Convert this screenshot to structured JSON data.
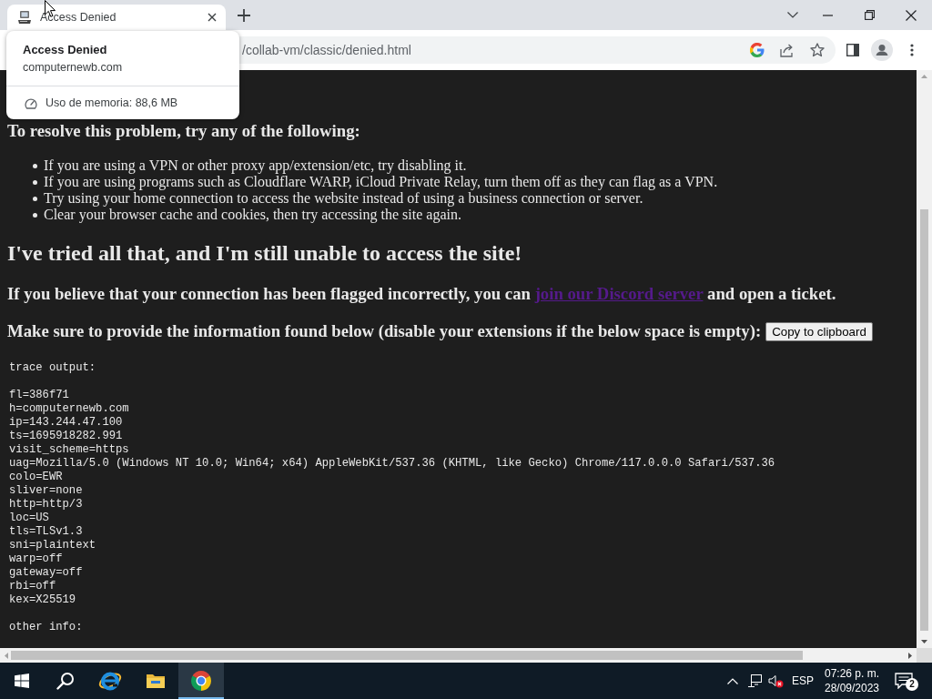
{
  "browser": {
    "tabs": [
      {
        "title": "Access Denied",
        "selected": true
      }
    ],
    "hover_card": {
      "title": "Access Denied",
      "domain": "computernewb.com",
      "memory": "Uso de memoria: 88,6 MB"
    },
    "address_bar": {
      "url": "/collab-vm/classic/denied.html"
    }
  },
  "page": {
    "heading": "To resolve this problem, try any of the following:",
    "tips": [
      "If you are using a VPN or other proxy app/extension/etc, try disabling it.",
      "If you are using programs such as Cloudflare WARP, iCloud Private Relay, turn them off as they can flag as a VPN.",
      "Try using your home connection to access the website instead of using a business connection or server.",
      "Clear your browser cache and cookies, then try accessing the site again."
    ],
    "subheading": "I've tried all that, and I'm still unable to access the site!",
    "flag_note": {
      "before": "If you believe that your connection has been flagged incorrectly, you can",
      "link": "join our Discord server",
      "after": "and open a ticket."
    },
    "info_note": "Make sure to provide the information found below (disable your extensions if the below space is empty):",
    "copy_button": "Copy to clipboard",
    "trace": {
      "title": "trace output:",
      "lines": [
        "fl=386f71",
        "h=computernewb.com",
        "ip=143.244.47.100",
        "ts=1695918282.991",
        "visit_scheme=https",
        "uag=Mozilla/5.0 (Windows NT 10.0; Win64; x64) AppleWebKit/537.36 (KHTML, like Gecko) Chrome/117.0.0.0 Safari/537.36",
        "colo=EWR",
        "sliver=none",
        "http=http/3",
        "loc=US",
        "tls=TLSv1.3",
        "sni=plaintext",
        "warp=off",
        "gateway=off",
        "rbi=off",
        "kex=X25519"
      ],
      "footer": "other info:"
    }
  },
  "taskbar": {
    "apps": [
      {
        "kind": "start",
        "selected": false
      },
      {
        "kind": "search",
        "selected": false
      },
      {
        "kind": "ie",
        "selected": false
      },
      {
        "kind": "explorer",
        "selected": false
      },
      {
        "kind": "chrome",
        "selected": true
      }
    ],
    "tray": {
      "language": "ESP",
      "time": "07:26 p. m.",
      "date": "28/09/2023",
      "volume_muted": true,
      "notifications": "2"
    }
  }
}
